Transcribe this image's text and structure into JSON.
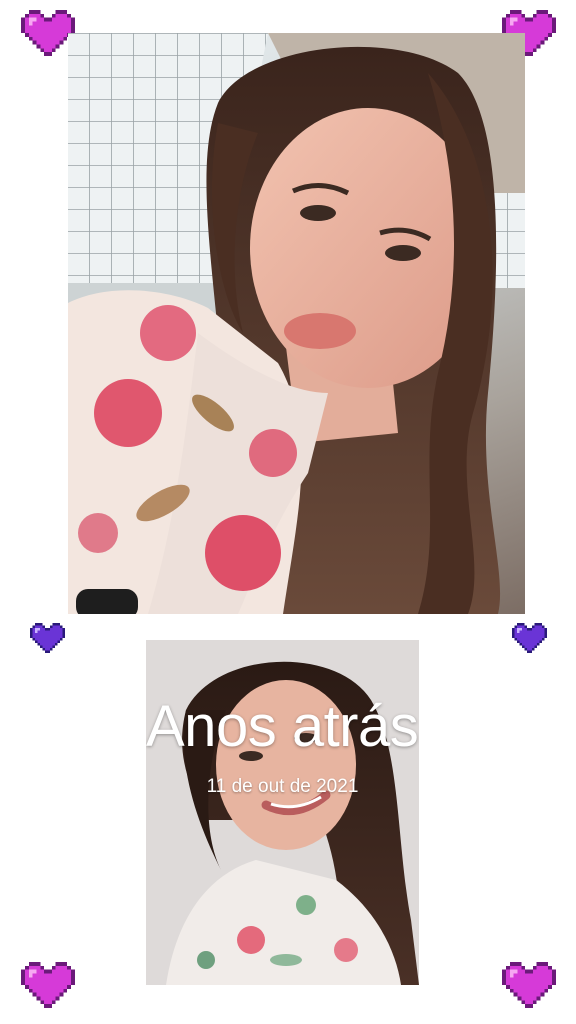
{
  "story": {
    "title": "Anos atrás",
    "date": "11 de out de 2021"
  },
  "decorations": {
    "hearts": [
      {
        "name": "pixel-heart-top-left-icon",
        "color": "#d63ad8"
      },
      {
        "name": "pixel-heart-top-right-icon",
        "color": "#d63ad8"
      },
      {
        "name": "pixel-heart-mid-left-icon",
        "color": "#6a34d6"
      },
      {
        "name": "pixel-heart-mid-right-icon",
        "color": "#6a34d6"
      },
      {
        "name": "pixel-heart-bottom-left-icon",
        "color": "#d63ad8"
      },
      {
        "name": "pixel-heart-bottom-right-icon",
        "color": "#d63ad8"
      }
    ]
  },
  "colors": {
    "background": "#ffffff",
    "text": "#ffffff",
    "heart_pink": "#d63ad8",
    "heart_purple": "#6a34d6"
  }
}
